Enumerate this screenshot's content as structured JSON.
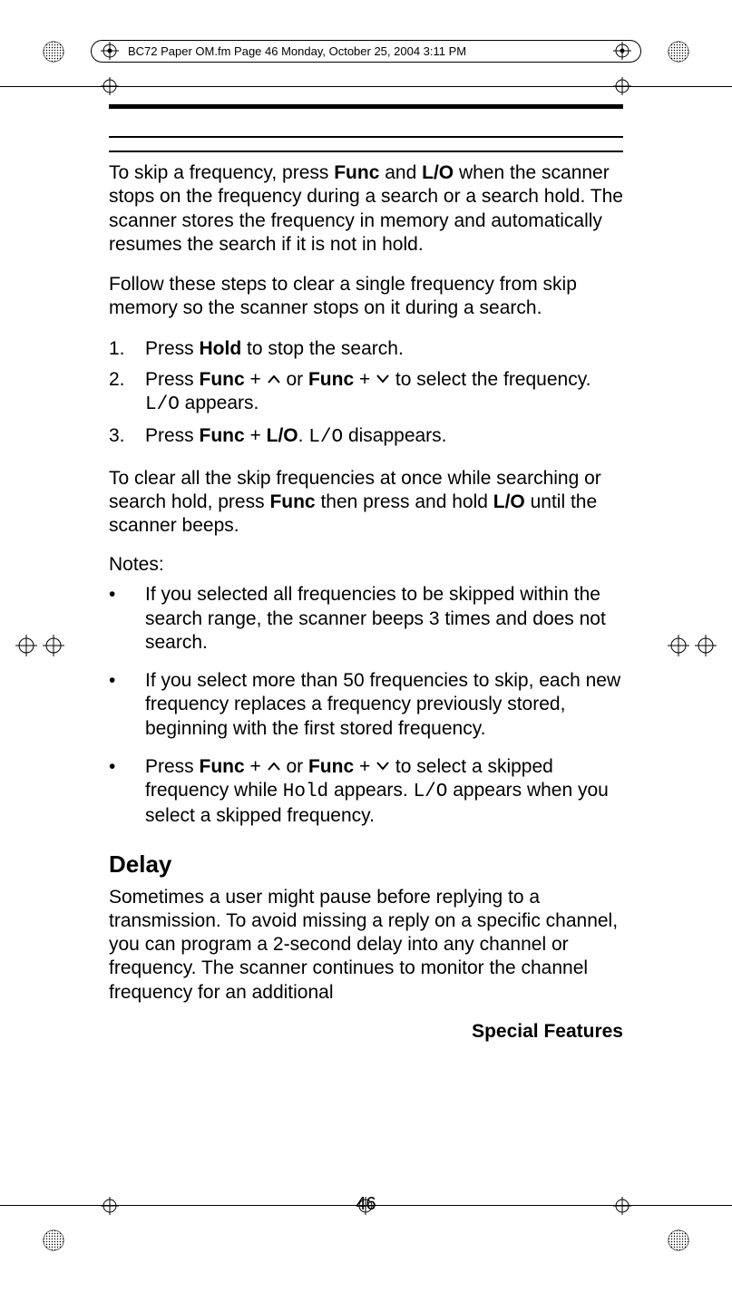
{
  "header": {
    "running_head": "BC72 Paper OM.fm  Page 46  Monday, October 25, 2004  3:11 PM"
  },
  "body": {
    "para1_part1": "To skip a frequency, press ",
    "para1_func": "Func",
    "para1_part2": " and ",
    "para1_lo": "L/O",
    "para1_part3": " when the scanner stops on the frequency during a search or a search hold. The scanner stores the frequency in memory and automatically resumes the search if it is not in hold.",
    "para2": "Follow these steps to clear a single frequency from skip memory so the scanner stops on it during a search.",
    "step1_num": "1.",
    "step1_part1": "Press ",
    "step1_hold": "Hold",
    "step1_part2": " to stop the search.",
    "step2_num": "2.",
    "step2_part1": "Press ",
    "step2_func1": "Func",
    "step2_part2": " + ",
    "step2_part3": " or ",
    "step2_func2": "Func",
    "step2_part4": " + ",
    "step2_part5": " to select the frequency. ",
    "step2_lo": "L/O",
    "step2_part6": " appears.",
    "step3_num": "3.",
    "step3_part1": "Press ",
    "step3_func": "Func",
    "step3_part2": " + ",
    "step3_lo_bold": "L/O",
    "step3_part3": ". ",
    "step3_lo_mono": "L/O",
    "step3_part4": " disappears.",
    "para3_part1": "To clear all the skip frequencies at once while searching or search hold, press ",
    "para3_func": "Func",
    "para3_part2": " then press and hold ",
    "para3_lo": "L/O",
    "para3_part3": " until the scanner beeps.",
    "notes_label": "Notes:",
    "note1": "If you selected all frequencies to be skipped within the search range, the scanner beeps 3 times and does not search.",
    "note2": "If you select more than 50 frequencies to skip, each new frequency replaces a frequency previously stored, beginning with the first stored frequency.",
    "note3_part1": "Press ",
    "note3_func1": "Func",
    "note3_part2": " + ",
    "note3_part3": " or ",
    "note3_func2": "Func",
    "note3_part4": " + ",
    "note3_part5": " to select a skipped frequency while ",
    "note3_hold": "Hold",
    "note3_part6": " appears. ",
    "note3_lo": "L/O",
    "note3_part7": " appears when you select a skipped frequency.",
    "heading_delay": "Delay",
    "para_delay": "Sometimes a user might pause before replying to a transmission. To avoid missing a reply on a specific channel, you can program a 2-second delay into any channel or frequency. The scanner continues to monitor the channel frequency for an additional",
    "footer_title": "Special Features",
    "page_number": "46",
    "bullet": "•"
  }
}
